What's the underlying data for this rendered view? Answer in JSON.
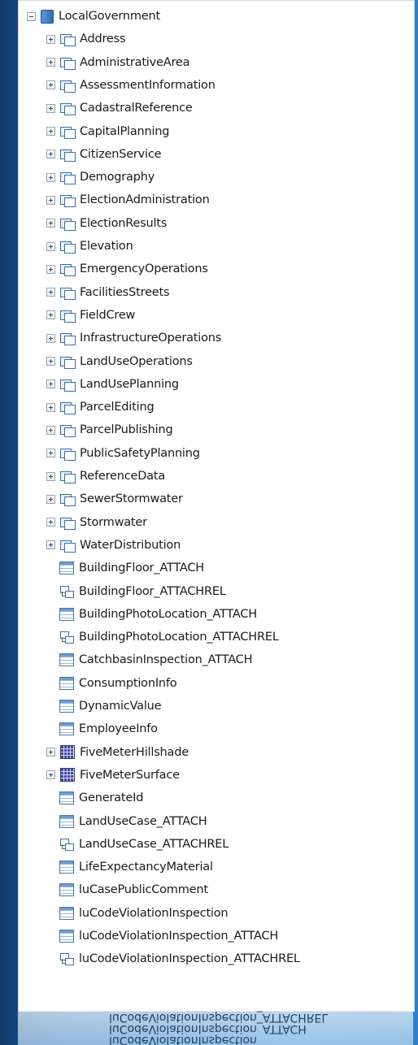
{
  "tree": {
    "root": {
      "label": "LocalGovernment",
      "icon": "geodatabase-icon"
    },
    "datasets": [
      {
        "label": "Address"
      },
      {
        "label": "AdministrativeArea"
      },
      {
        "label": "AssessmentInformation"
      },
      {
        "label": "CadastralReference"
      },
      {
        "label": "CapitalPlanning"
      },
      {
        "label": "CitizenService"
      },
      {
        "label": "Demography"
      },
      {
        "label": "ElectionAdministration"
      },
      {
        "label": "ElectionResults"
      },
      {
        "label": "Elevation"
      },
      {
        "label": "EmergencyOperations"
      },
      {
        "label": "FacilitiesStreets"
      },
      {
        "label": "FieldCrew"
      },
      {
        "label": "InfrastructureOperations"
      },
      {
        "label": "LandUseOperations"
      },
      {
        "label": "LandUsePlanning"
      },
      {
        "label": "ParcelEditing"
      },
      {
        "label": "ParcelPublishing"
      },
      {
        "label": "PublicSafetyPlanning"
      },
      {
        "label": "ReferenceData"
      },
      {
        "label": "SewerStormwater"
      },
      {
        "label": "Stormwater"
      },
      {
        "label": "WaterDistribution"
      }
    ],
    "items": [
      {
        "label": "BuildingFloor_ATTACH",
        "kind": "table",
        "icon": "table-icon"
      },
      {
        "label": "BuildingFloor_ATTACHREL",
        "kind": "relationship",
        "icon": "relationship-class-icon"
      },
      {
        "label": "BuildingPhotoLocation_ATTACH",
        "kind": "table",
        "icon": "table-icon"
      },
      {
        "label": "BuildingPhotoLocation_ATTACHREL",
        "kind": "relationship",
        "icon": "relationship-class-icon"
      },
      {
        "label": "CatchbasinInspection_ATTACH",
        "kind": "table",
        "icon": "table-icon"
      },
      {
        "label": "ConsumptionInfo",
        "kind": "table",
        "icon": "table-icon"
      },
      {
        "label": "DynamicValue",
        "kind": "table",
        "icon": "table-icon"
      },
      {
        "label": "EmployeeInfo",
        "kind": "table",
        "icon": "table-icon"
      },
      {
        "label": "FiveMeterHillshade",
        "kind": "raster",
        "icon": "raster-dataset-icon"
      },
      {
        "label": "FiveMeterSurface",
        "kind": "raster",
        "icon": "raster-dataset-icon"
      },
      {
        "label": "GenerateId",
        "kind": "table",
        "icon": "table-icon"
      },
      {
        "label": "LandUseCase_ATTACH",
        "kind": "table",
        "icon": "table-icon"
      },
      {
        "label": "LandUseCase_ATTACHREL",
        "kind": "relationship",
        "icon": "relationship-class-icon"
      },
      {
        "label": "LifeExpectancyMaterial",
        "kind": "table",
        "icon": "table-icon"
      },
      {
        "label": "luCasePublicComment",
        "kind": "table",
        "icon": "table-icon"
      },
      {
        "label": "luCodeViolationInspection",
        "kind": "table",
        "icon": "table-icon"
      },
      {
        "label": "luCodeViolationInspection_ATTACH",
        "kind": "table",
        "icon": "table-icon"
      },
      {
        "label": "luCodeViolationInspection_ATTACHREL",
        "kind": "relationship",
        "icon": "relationship-class-icon"
      }
    ]
  },
  "reflection": [
    "luCodeViolationInspection_ATTACHREL",
    "luCodeViolationInspection_ATTACH",
    "luCodeViolationInspection"
  ]
}
